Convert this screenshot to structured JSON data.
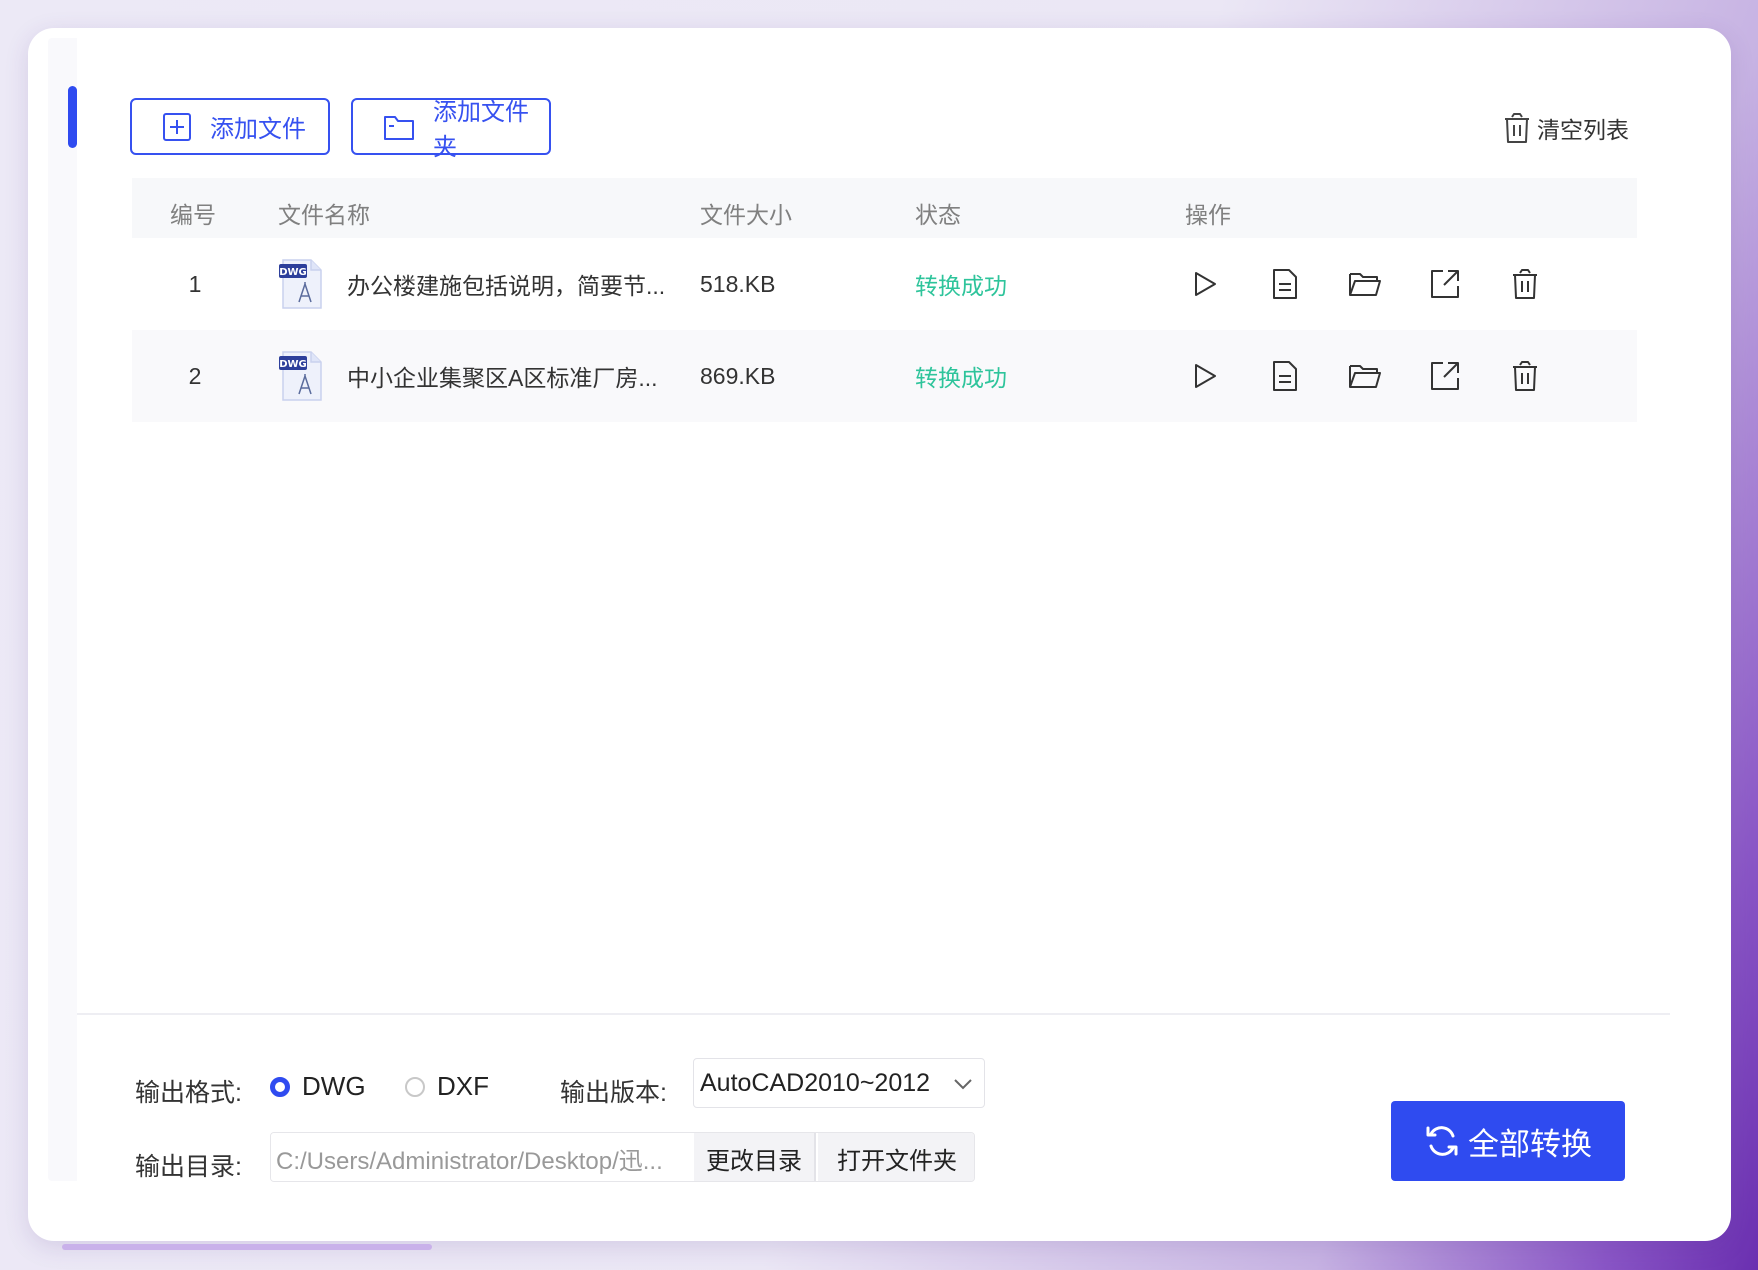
{
  "toolbar": {
    "add_file": "添加文件",
    "add_folder": "添加文件夹",
    "clear_list": "清空列表"
  },
  "table": {
    "headers": [
      "编号",
      "文件名称",
      "文件大小",
      "状态",
      "操作"
    ],
    "rows": [
      {
        "num": "1",
        "icon": "dwg-file-icon",
        "name": "办公楼建施包括说明，简要节...",
        "size": "518.KB",
        "status": "转换成功"
      },
      {
        "num": "2",
        "icon": "dwg-file-icon",
        "name": "中小企业集聚区A区标准厂房...",
        "size": "869.KB",
        "status": "转换成功"
      }
    ],
    "icon_badge": "DWG",
    "actions": [
      "play-icon",
      "document-icon",
      "folder-open-icon",
      "external-link-icon",
      "trash-icon"
    ]
  },
  "output": {
    "format_label": "输出格式:",
    "formats": [
      {
        "label": "DWG",
        "selected": true
      },
      {
        "label": "DXF",
        "selected": false
      }
    ],
    "version_label": "输出版本:",
    "version_value": "AutoCAD2010~2012",
    "dir_label": "输出目录:",
    "dir_value": "C:/Users/Administrator/Desktop/迅...",
    "change_dir": "更改目录",
    "open_folder": "打开文件夹",
    "convert_all": "全部转换"
  },
  "colors": {
    "accent": "#2f4bf0",
    "success": "#2ec49b",
    "text": "#333333",
    "muted": "#808080"
  }
}
